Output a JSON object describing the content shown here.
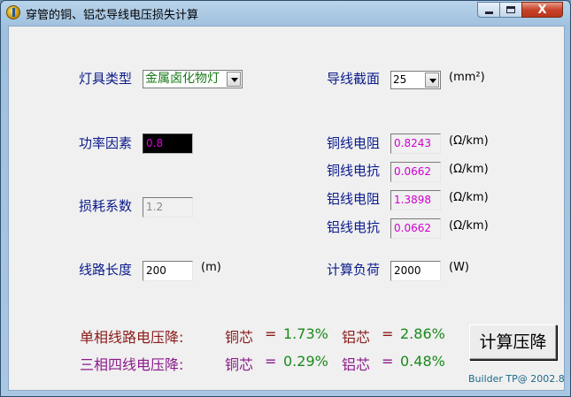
{
  "window": {
    "title": "穿管的铜、铝芯导线电压损失计算",
    "close_glyph": "X"
  },
  "left": {
    "lamp_type_label": "灯具类型",
    "lamp_type_value": "金属卤化物灯",
    "power_factor_label": "功率因素",
    "power_factor_value": "0.8",
    "loss_factor_label": "损耗系数",
    "loss_factor_value": "1.2",
    "line_length_label": "线路长度",
    "line_length_value": "200",
    "line_length_unit": "(m)"
  },
  "right": {
    "cross_section_label": "导线截面",
    "cross_section_value": "25",
    "cross_section_unit": "(mm²)",
    "cu_resistance_label": "铜线电阻",
    "cu_resistance_value": "0.8243",
    "cu_resistance_unit": "(Ω/km)",
    "cu_reactance_label": "铜线电抗",
    "cu_reactance_value": "0.0662",
    "cu_reactance_unit": "(Ω/km)",
    "al_resistance_label": "铝线电阻",
    "al_resistance_value": "1.3898",
    "al_resistance_unit": "(Ω/km)",
    "al_reactance_label": "铝线电抗",
    "al_reactance_value": "0.0662",
    "al_reactance_unit": "(Ω/km)",
    "load_label": "计算负荷",
    "load_value": "2000",
    "load_unit": "(W)"
  },
  "results": {
    "single_phase_label": "单相线路电压降:",
    "three_phase_label": "三相四线电压降:",
    "cu_label": "铜芯",
    "al_label": "铝芯",
    "eq": "=",
    "single_cu": "1.73%",
    "single_al": "2.86%",
    "three_cu": "0.29%",
    "three_al": "0.48%"
  },
  "calc_button_label": "计算压降",
  "footer": "Builder TP@ 2002.8",
  "colors": {
    "label": "#0b1b8a",
    "single_phase": "#8b1a1a",
    "three_phase": "#8b1a8b",
    "result_value": "#1a8a1a",
    "readonly_value": "#d000d0"
  }
}
